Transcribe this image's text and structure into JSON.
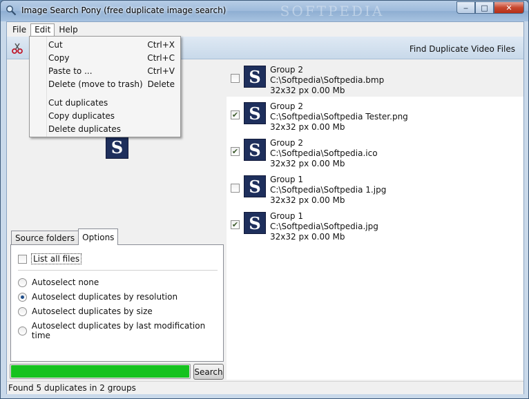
{
  "window": {
    "title": "Image Search Pony (free duplicate image search)",
    "watermark": "SOFTPEDIA"
  },
  "caption": {
    "minimize": "‒",
    "maximize": "□",
    "close": "✕"
  },
  "menu": {
    "file": "File",
    "edit": "Edit",
    "help": "Help"
  },
  "context_menu": {
    "items": [
      {
        "label": "Cut",
        "shortcut": "Ctrl+X"
      },
      {
        "label": "Copy",
        "shortcut": "Ctrl+C"
      },
      {
        "label": "Paste to ...",
        "shortcut": "Ctrl+V"
      },
      {
        "label": "Delete (move to trash)",
        "shortcut": "Delete"
      },
      {
        "label": "Cut duplicates",
        "shortcut": ""
      },
      {
        "label": "Copy duplicates",
        "shortcut": ""
      },
      {
        "label": "Delete duplicates",
        "shortcut": ""
      }
    ]
  },
  "toolbar": {
    "find_video": "Find Duplicate Video Files"
  },
  "tabs": {
    "source": "Source folders",
    "options": "Options"
  },
  "options": {
    "list_all": "List all files",
    "radios": [
      {
        "label": "Autoselect none",
        "selected": false
      },
      {
        "label": "Autoselect duplicates by resolution",
        "selected": true
      },
      {
        "label": "Autoselect duplicates by size",
        "selected": false
      },
      {
        "label": "Autoselect duplicates by last modification time",
        "selected": false
      }
    ]
  },
  "search": {
    "label": "Search",
    "progress": 1.0,
    "progress_color": "#16c21f"
  },
  "status": "Found 5 duplicates in 2 groups",
  "thumb_letter": "S",
  "results": [
    {
      "group": "Group 2",
      "path": "C:\\Softpedia\\Softpedia.bmp",
      "info": "32x32 px 0.00 Mb",
      "checked": false
    },
    {
      "group": "Group 2",
      "path": "C:\\Softpedia\\Softpedia Tester.png",
      "info": "32x32 px 0.00 Mb",
      "checked": true
    },
    {
      "group": "Group 2",
      "path": "C:\\Softpedia\\Softpedia.ico",
      "info": "32x32 px 0.00 Mb",
      "checked": true
    },
    {
      "group": "Group 1",
      "path": "C:\\Softpedia\\Softpedia 1.jpg",
      "info": "32x32 px 0.00 Mb",
      "checked": false
    },
    {
      "group": "Group 1",
      "path": "C:\\Softpedia\\Softpedia.jpg",
      "info": "32x32 px 0.00 Mb",
      "checked": true
    }
  ]
}
